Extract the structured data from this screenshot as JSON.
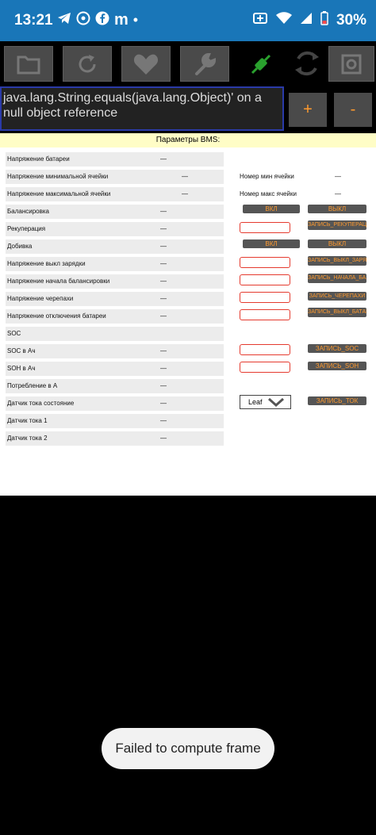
{
  "status": {
    "time": "13:21",
    "battery": "30%",
    "app_m": "m"
  },
  "error": {
    "text": "java.lang.String.equals(java.lang.Object)' on a null object reference"
  },
  "controls": {
    "plus": "+",
    "minus": "-"
  },
  "panel": {
    "title": "Параметры BMS:",
    "rows": [
      {
        "label": "Напряжение батареи",
        "value": "—"
      },
      {
        "label": "Напряжение минимальной ячейки",
        "value": "—"
      },
      {
        "label": "Напряжение максимальной ячейки",
        "value": "—"
      },
      {
        "label": "Балансировка",
        "value": "—"
      },
      {
        "label": "Рекуперация",
        "value": "—"
      },
      {
        "label": "Добивка",
        "value": "—"
      },
      {
        "label": "Напряжение выкл зарядки",
        "value": "—"
      },
      {
        "label": "Напряжение начала балансировки",
        "value": "—"
      },
      {
        "label": "Напряжение черепахи",
        "value": "—"
      },
      {
        "label": "Напряжение отключения батареи",
        "value": "—"
      },
      {
        "label": "SOC",
        "value": ""
      },
      {
        "label": "SOC в Ач",
        "value": "—"
      },
      {
        "label": "SOH в Ач",
        "value": "—"
      },
      {
        "label": "Потребление в А",
        "value": "—"
      },
      {
        "label": "Датчик тока состояние",
        "value": "—"
      },
      {
        "label": "Датчик тока 1",
        "value": "—"
      },
      {
        "label": "Датчик тока 2",
        "value": "—"
      }
    ],
    "min_cell_label": "Номер мин ячейки",
    "min_cell_value": "—",
    "max_cell_label": "Номер макс ячейки",
    "max_cell_value": "—",
    "buttons": {
      "on_1": "ВКЛ",
      "off_1": "ВЫКЛ",
      "write_recup": "ЗАПИСЬ_РЕКУПЕРАЦИИ",
      "on_2": "ВКЛ",
      "off_2": "ВЫКЛ",
      "write_charge_off": "ЗАПИСЬ_ВЫКЛ_ЗАРЯДКИ",
      "write_balance_start": "ЗАПИСЬ_НАЧАЛА_БАЛАНСИРОВКИ",
      "write_turtle": "ЗАПИСЬ_ЧЕРЕПАХИ",
      "write_batt_off": "ЗАПИСЬ_ВЫКЛ_БАТАРЕИ",
      "write_soc": "ЗАПИСЬ_SOC",
      "write_soh": "ЗАПИСЬ_SOH",
      "write_current": "ЗАПИСЬ_ТОК"
    },
    "sensor_select": "Leaf"
  },
  "toast": {
    "text": "Failed to compute frame"
  }
}
